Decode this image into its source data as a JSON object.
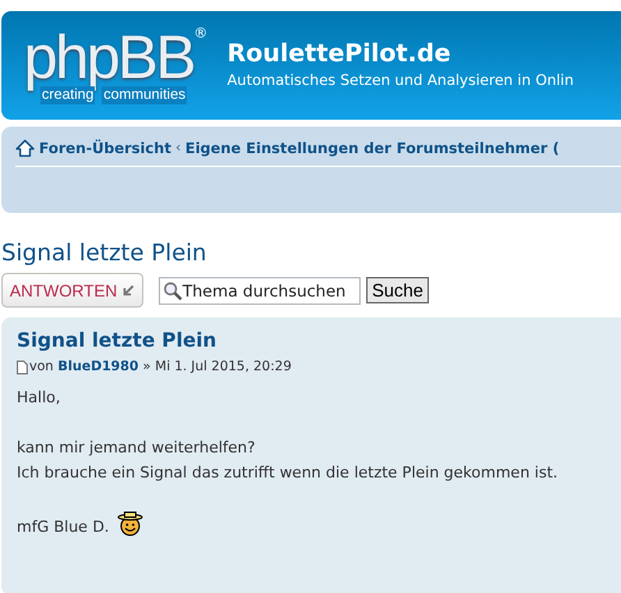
{
  "header": {
    "logo": {
      "text": "phpBB",
      "mark": "®",
      "tagline": [
        "creating",
        "communities"
      ]
    },
    "site_title": "RoulettePilot.de",
    "site_description": "Automatisches Setzen und Analysieren in Onlin"
  },
  "breadcrumbs": {
    "separator": "‹",
    "items": [
      {
        "label": "Foren-Übersicht"
      },
      {
        "label": "Eigene Einstellungen der Forumsteilnehmer ("
      }
    ]
  },
  "topic_title": "Signal letzte Plein",
  "actions": {
    "reply_button": "ANTWORTEN",
    "search": {
      "placeholder": "Thema durchsuchen"
    },
    "search_button": "Suche"
  },
  "post": {
    "title": "Signal letzte Plein",
    "author_prefix": "von",
    "author": "BlueD1980",
    "separator": "»",
    "date": "Mi 1. Jul 2015, 20:29",
    "paragraphs": [
      {
        "kind": "text",
        "lines": [
          "Hallo,"
        ]
      },
      {
        "kind": "text",
        "lines": [
          "kann mir jemand weiterhelfen?",
          "Ich brauche ein Signal das zutrifft wenn die letzte Plein gekommen ist."
        ]
      },
      {
        "kind": "signature",
        "lines": [
          "mfG Blue D."
        ],
        "smiley": true
      }
    ]
  }
}
